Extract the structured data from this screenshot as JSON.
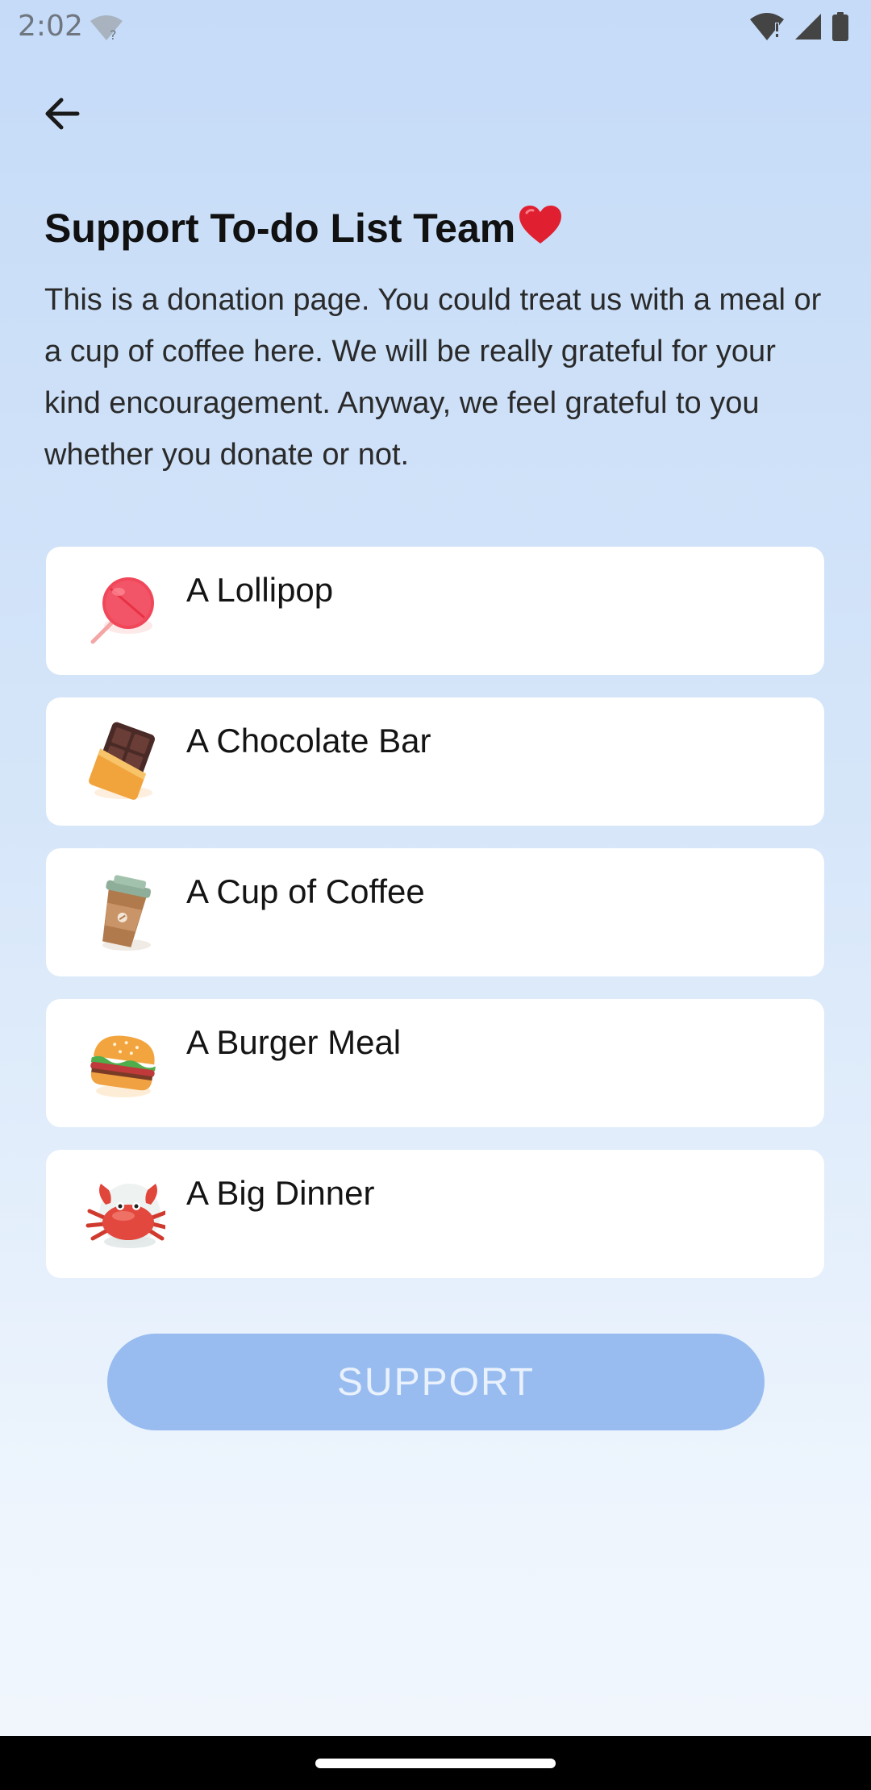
{
  "status_bar": {
    "time": "2:02",
    "icons": [
      "wifi-unknown-icon",
      "wifi-alert-icon",
      "signal-icon",
      "battery-icon"
    ]
  },
  "header": {
    "back_icon": "arrow-left-icon"
  },
  "page": {
    "title": "Support To-do List Team",
    "title_icon": "heart-icon",
    "description": "This is a donation page. You could treat us with a meal or a cup of coffee here. We will be really grateful for your kind encouragement. Anyway, we feel grateful to you whether you donate or not."
  },
  "options": [
    {
      "label": "A Lollipop",
      "icon": "lollipop-icon"
    },
    {
      "label": "A Chocolate Bar",
      "icon": "chocolate-bar-icon"
    },
    {
      "label": "A Cup of Coffee",
      "icon": "coffee-cup-icon"
    },
    {
      "label": "A Burger Meal",
      "icon": "burger-icon"
    },
    {
      "label": "A Big Dinner",
      "icon": "crab-icon"
    }
  ],
  "support_button": {
    "label": "SUPPORT",
    "enabled": false
  },
  "colors": {
    "background_top": "#c5dbf8",
    "background_bottom": "#f2f7fd",
    "button_disabled": "#98bcf0",
    "card": "#ffffff"
  }
}
